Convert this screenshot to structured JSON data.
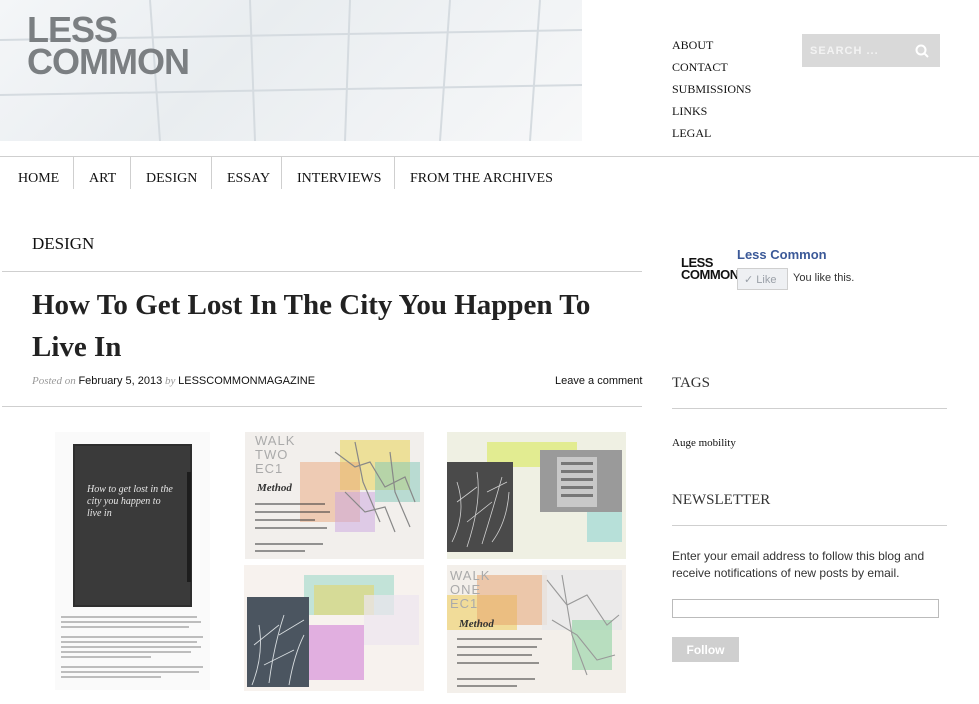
{
  "logo": {
    "line1": "LESS",
    "line2": "COMMON"
  },
  "top_links": [
    "ABOUT",
    "CONTACT",
    "SUBMISSIONS",
    "LINKS",
    "LEGAL"
  ],
  "search": {
    "placeholder": "SEARCH ..."
  },
  "nav": [
    "HOME",
    "ART",
    "DESIGN",
    "ESSAY",
    "INTERVIEWS",
    "FROM THE ARCHIVES"
  ],
  "main": {
    "category": "DESIGN",
    "post_title": "How To Get Lost In The City You Happen To Live In",
    "posted_on_label": "Posted on",
    "date": "February 5, 2013",
    "by_label": "by",
    "author": "LESSCOMMONMAGAZINE",
    "comment_link": "Leave a comment",
    "thumbnails": {
      "book_cover_text": "How to get lost in the city you happen to live in",
      "walk_two": [
        "WALK",
        "TWO",
        "EC1",
        "Method"
      ],
      "walk_one": [
        "WALK",
        "ONE",
        "EC1",
        "Method"
      ]
    }
  },
  "sidebar": {
    "fb_logo": {
      "line1": "LESS",
      "line2": "COMMON"
    },
    "fb_name": "Less Common",
    "fb_like": "Like",
    "fb_you_like": "You like this.",
    "tags_heading": "TAGS",
    "tag": "Auge mobility",
    "newsletter_heading": "NEWSLETTER",
    "newsletter_text": "Enter your email address to follow this blog and receive notifications of new posts by email.",
    "follow_button": "Follow"
  },
  "colors": {
    "link_blue": "#3b5998",
    "logo_grey": "#7b7f82",
    "search_bg": "#d9d9d9"
  }
}
